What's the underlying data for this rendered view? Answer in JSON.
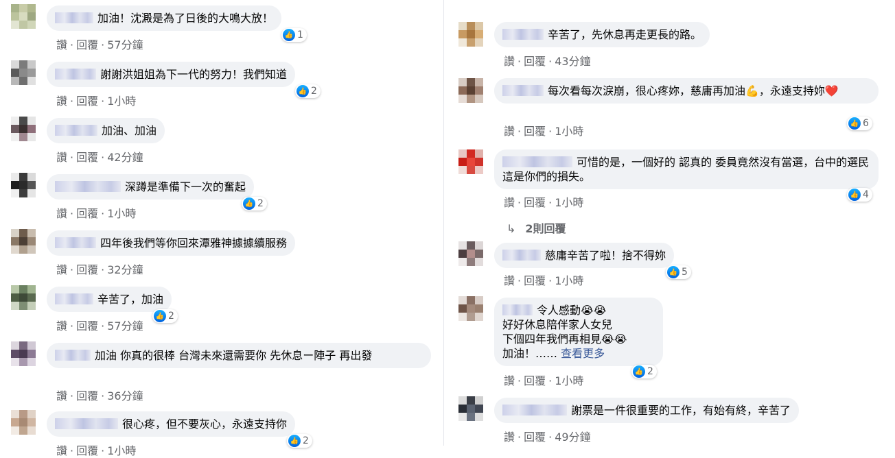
{
  "actions": {
    "read": "讚",
    "reply": "回覆",
    "sep": "·"
  },
  "colors": {
    "bubble": "#f0f2f5",
    "meta": "#65676b",
    "like": "#1877f2"
  },
  "left_comments": [
    {
      "text": "加油！沈澱是為了日後的大鳴大放！",
      "time": "57分鐘",
      "likes": "1"
    },
    {
      "text": "謝謝洪姐姐為下一代的努力！我們知道",
      "time": "1小時",
      "likes": "2"
    },
    {
      "text": "加油、加油",
      "time": "42分鐘",
      "likes": ""
    },
    {
      "text": "深蹲是準備下一次的奮起",
      "time": "1小時",
      "likes": "2"
    },
    {
      "text": "四年後我們等你回來潭雅神據據續服務",
      "time": "32分鐘",
      "likes": ""
    },
    {
      "text": "辛苦了，加油",
      "time": "57分鐘",
      "likes": "2"
    },
    {
      "text": "加油 你真的很棒 台灣未來還需要你 先休息ー陣子 再出發",
      "time": "36分鐘",
      "likes": ""
    },
    {
      "text": "很心疼，但不要灰心，永遠支持你",
      "time": "1小時",
      "likes": "2"
    }
  ],
  "right_comments": [
    {
      "text": "辛苦了，先休息再走更長的路。",
      "time": "43分鐘",
      "likes": ""
    },
    {
      "text": "每次看每次淚崩，很心疼妳，慈庸再加油💪，永遠支持妳❤️",
      "time": "1小時",
      "likes": "6"
    },
    {
      "text": "可惜的是，一個好的 認真的 委員竟然沒有當選，台中的選民 這是你們的損失。",
      "time": "1小時",
      "likes": "4"
    },
    {
      "text": "慈庸辛苦了啦！捨不得妳",
      "time": "1小時",
      "likes": "5"
    },
    {
      "text": "令人感動😭😭",
      "line2": "好好休息陪伴家人女兒",
      "line3": "下個四年我們再相見😭😭",
      "line4": "加油！……",
      "more": "查看更多",
      "time": "1小時",
      "likes": "2"
    },
    {
      "text": "謝票是一件很重要的工作，有始有終，辛苦了",
      "time": "49分鐘",
      "likes": ""
    }
  ],
  "replies_link": {
    "arrow": "↳",
    "label": "2則回覆"
  }
}
